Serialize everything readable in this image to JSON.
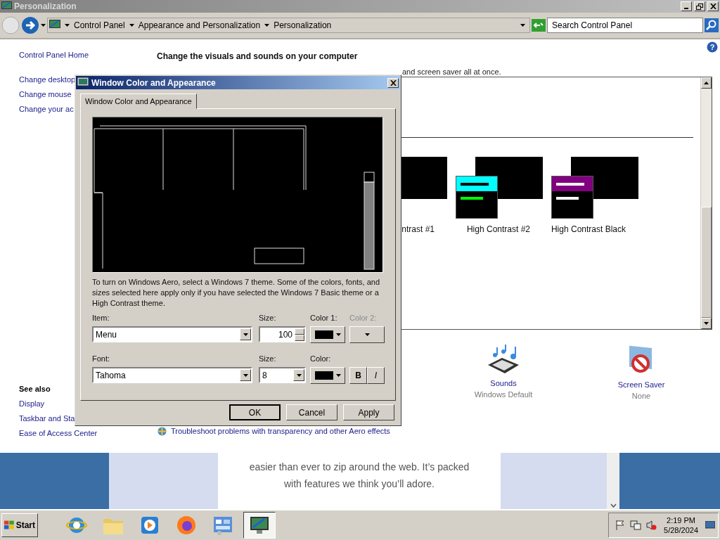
{
  "window": {
    "title": "Personalization"
  },
  "address_bar": {
    "crumbs": [
      "Control Panel",
      "Appearance and Personalization",
      "Personalization"
    ],
    "search": {
      "placeholder": "Search Control Panel"
    }
  },
  "help": "?",
  "sidebar": {
    "links": [
      "Control Panel Home",
      "Change desktop",
      "Change mouse",
      "Change your ac"
    ],
    "see_also": {
      "title": "See also",
      "links": [
        "Display",
        "Taskbar and Sta",
        "Ease of Access Center"
      ]
    }
  },
  "main": {
    "heading": "Change the visuals and sounds on your computer",
    "intro": "and screen saver all at once.",
    "themes": [
      {
        "label": "ntrast #1"
      },
      {
        "label": "High Contrast #2",
        "color": "#00ffff",
        "bars": [
          {
            "color": "#000000"
          },
          {
            "color": "#00ff00"
          }
        ]
      },
      {
        "label": "High Contrast Black",
        "color": "#800080",
        "bars": [
          {
            "color": "#ffffff"
          },
          {
            "color": "#ffffff"
          }
        ]
      }
    ],
    "settings": [
      {
        "kind": "sounds",
        "label": "Sounds",
        "value": "Windows Default"
      },
      {
        "kind": "screensaver",
        "label": "Screen Saver",
        "value": "None"
      }
    ],
    "troubleshoot_link": "Troubleshoot problems with transparency and other Aero effects"
  },
  "dialog": {
    "title": "Window Color and Appearance",
    "tabs": [
      {
        "label": "Window Color and Appearance",
        "selected": true
      }
    ],
    "note": "To turn on Windows Aero, select a Windows 7 theme.  Some of the colors, fonts, and sizes selected here apply only if you have selected the Windows 7 Basic theme or a High Contrast theme.",
    "item": {
      "label": "Item:",
      "value": "Menu"
    },
    "item_size": {
      "label": "Size:",
      "value": "100"
    },
    "color1": {
      "label": "Color 1:",
      "color": "#000000"
    },
    "color2": {
      "label": "Color 2:",
      "disabled": true
    },
    "font": {
      "label": "Font:",
      "value": "Tahoma"
    },
    "font_size": {
      "label": "Size:",
      "value": "8"
    },
    "font_color": {
      "label": "Color:",
      "color": "#000000"
    },
    "bold": {
      "label": "B",
      "selected": false
    },
    "italic": {
      "label": "I",
      "selected": false
    },
    "buttons": [
      {
        "label": "OK",
        "default": true
      },
      {
        "label": "Cancel",
        "default": false
      },
      {
        "label": "Apply",
        "default": false
      }
    ]
  },
  "browser_fragment": {
    "lines": [
      "easier than ever to zip around the web. It’s packed",
      "with features we think you’ll adore."
    ]
  },
  "taskbar": {
    "start": "Start",
    "apps": [
      {
        "kind": "ie",
        "selected": false
      },
      {
        "kind": "folder",
        "selected": false
      },
      {
        "kind": "media",
        "selected": false
      },
      {
        "kind": "firefox",
        "selected": false
      },
      {
        "kind": "control",
        "selected": false
      },
      {
        "kind": "personalize",
        "selected": true
      }
    ],
    "clock": {
      "time": "2:19 PM",
      "date": "5/28/2024"
    }
  }
}
